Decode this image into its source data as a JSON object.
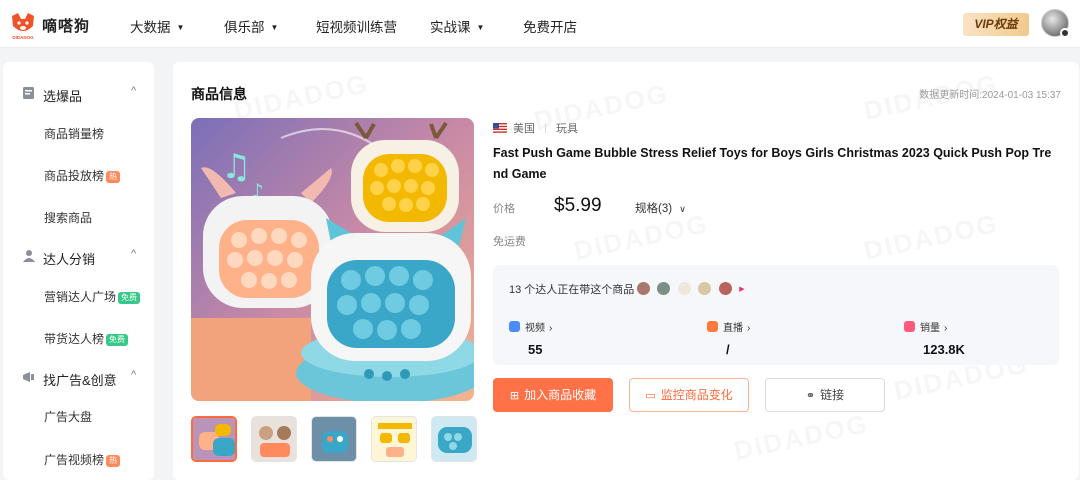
{
  "app": {
    "brand": "嘀嗒狗",
    "logo_text": "DIDADOG"
  },
  "nav": {
    "items": [
      {
        "label": "大数据",
        "has_dropdown": true
      },
      {
        "label": "俱乐部",
        "has_dropdown": true
      },
      {
        "label": "短视频训练营",
        "has_dropdown": false
      },
      {
        "label": "实战课",
        "has_dropdown": true
      },
      {
        "label": "免费开店",
        "has_dropdown": false
      }
    ],
    "vip_label": "VIP权益"
  },
  "sidebar": {
    "sections": [
      {
        "title": "选爆品",
        "icon": "box-icon",
        "items": [
          {
            "label": "商品销量榜",
            "tag": ""
          },
          {
            "label": "商品投放榜",
            "tag": "热"
          },
          {
            "label": "搜索商品",
            "tag": ""
          }
        ]
      },
      {
        "title": "达人分销",
        "icon": "person-icon",
        "items": [
          {
            "label": "营销达人广场",
            "tag": "免费"
          },
          {
            "label": "带货达人榜",
            "tag": "免费"
          }
        ]
      },
      {
        "title": "找广告&创意",
        "icon": "megaphone-icon",
        "items": [
          {
            "label": "广告大盘",
            "tag": ""
          },
          {
            "label": "广告视频榜",
            "tag": "热"
          }
        ]
      }
    ]
  },
  "product": {
    "section_title": "商品信息",
    "update_time": "数据更新时间:2024-01-03 15:37",
    "country": "美国",
    "category": "玩具",
    "title": "Fast Push Game Bubble Stress Relief Toys for Boys Girls Christmas 2023 Quick Push Pop Trend Game",
    "price_label": "价格",
    "price": "$5.99",
    "spec_label": "规格(3)",
    "shipping": "免运费",
    "influencers_text": "13 个达人正在带这个商品",
    "stats": [
      {
        "label": "视频",
        "value": "55",
        "color": "#4a8cff"
      },
      {
        "label": "直播",
        "value": "/",
        "color": "#ff7a3d"
      },
      {
        "label": "销量",
        "value": "123.8K",
        "color": "#ff5a7a"
      }
    ],
    "buttons": {
      "favorite": "加入商品收藏",
      "monitor": "监控商品变化",
      "link": "链接"
    },
    "thumbnail_count": 5
  },
  "colors": {
    "accent": "#ff7248",
    "free_tag": "#38c98a",
    "hot_tag": "#ff8a5c"
  }
}
